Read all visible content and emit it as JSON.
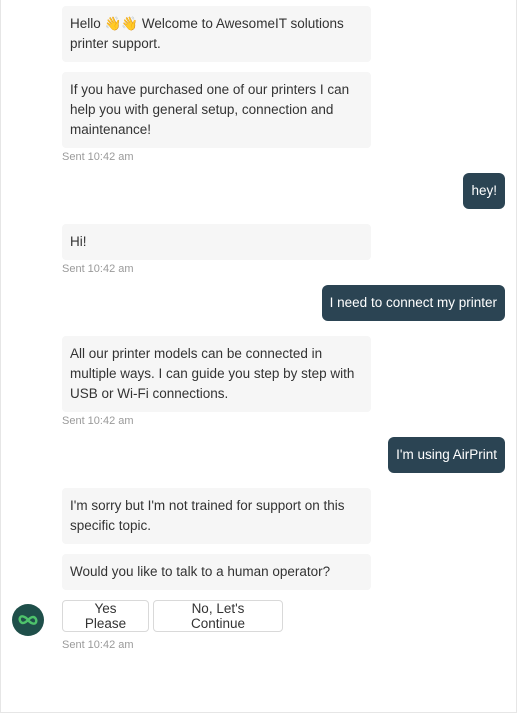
{
  "messages": {
    "bot1": "Hello 👋👋 Welcome to AwesomeIT solutions printer support.",
    "bot2": "If you have purchased one of our printers I can help you with general setup, connection and maintenance!",
    "ts1": "Sent 10:42 am",
    "user1": "hey!",
    "bot3": "Hi!",
    "ts2": "Sent 10:42 am",
    "user2": "I need to connect my printer",
    "bot4": "All our printer models can be connected in multiple ways. I can guide you step by step with USB or Wi-Fi connections.",
    "ts3": "Sent 10:42 am",
    "user3": "I'm using AirPrint",
    "bot5": "I'm sorry but I'm not trained for support on this specific topic.",
    "bot6": "Would you like to talk to a human operator?",
    "ts4": "Sent 10:42 am"
  },
  "quick_replies": {
    "yes": "Yes Please",
    "no": "No, Let's Continue"
  },
  "avatar": {
    "icon": "infinity-icon",
    "bg": "#1f4f4a",
    "fg": "#4ec36b"
  },
  "colors": {
    "user_bubble": "#2b4453",
    "bot_bubble": "#f6f6f6"
  }
}
